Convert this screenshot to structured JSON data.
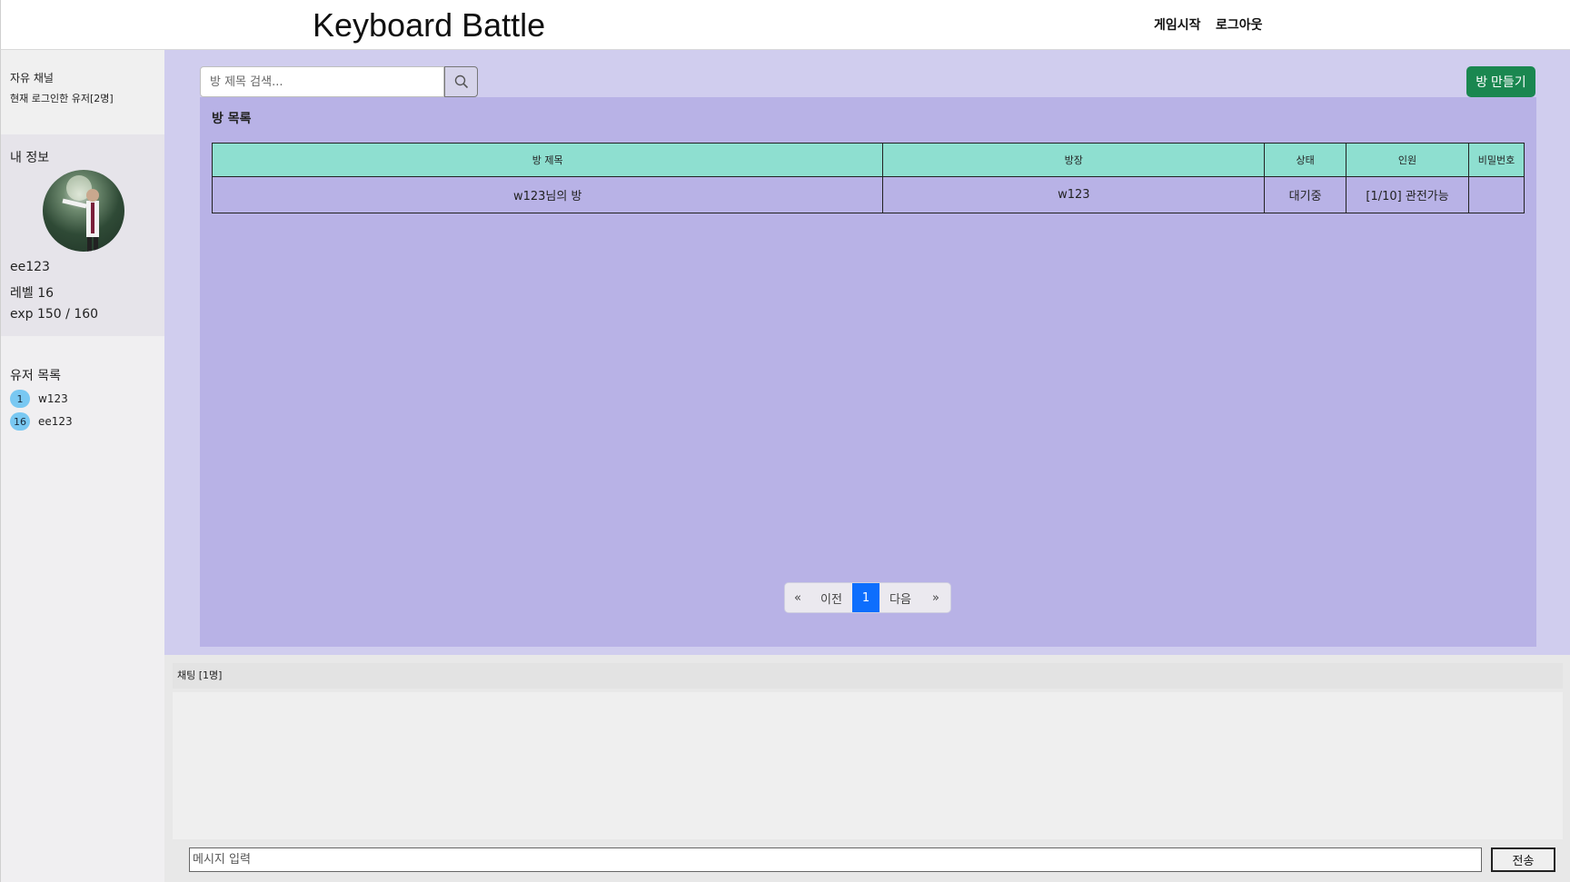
{
  "header": {
    "brand": "Keyboard Battle",
    "nav": {
      "start": "게임시작",
      "logout": "로그아웃"
    }
  },
  "sidebar": {
    "channel": {
      "title": "자유 채널",
      "users": "현재 로그인한 유저[2명]"
    },
    "my_info": {
      "title": "내 정보",
      "name": "ee123",
      "level": "레벨 16",
      "exp": "exp 150 / 160"
    },
    "user_list": {
      "title": "유저 목록",
      "users": [
        {
          "level": "1",
          "name": "w123"
        },
        {
          "level": "16",
          "name": "ee123"
        }
      ]
    }
  },
  "main": {
    "search": {
      "placeholder": "방 제목 검색..."
    },
    "create_button": "방 만들기",
    "room_list": {
      "title": "방 목록",
      "columns": [
        "방 제목",
        "방장",
        "상태",
        "인원",
        "비밀번호"
      ],
      "rows": [
        {
          "title": "w123님의 방",
          "owner": "w123",
          "status": "대기중",
          "members": "[1/10] 관전가능",
          "password": ""
        }
      ]
    },
    "pagination": {
      "first": "«",
      "prev": "이전",
      "current": "1",
      "next": "다음",
      "last": "»"
    }
  },
  "chat": {
    "header": "채팅 [1명]",
    "input_placeholder": "메시지 입력",
    "send": "전송"
  },
  "colors": {
    "main_bg": "#d0cdee",
    "panel_bg": "#b8b2e6",
    "table_header": "#8edfd0",
    "create_button": "#1a8750",
    "active_page": "#0d6efd",
    "level_badge": "#79c8f2"
  },
  "icons": {
    "search": "search-icon"
  }
}
